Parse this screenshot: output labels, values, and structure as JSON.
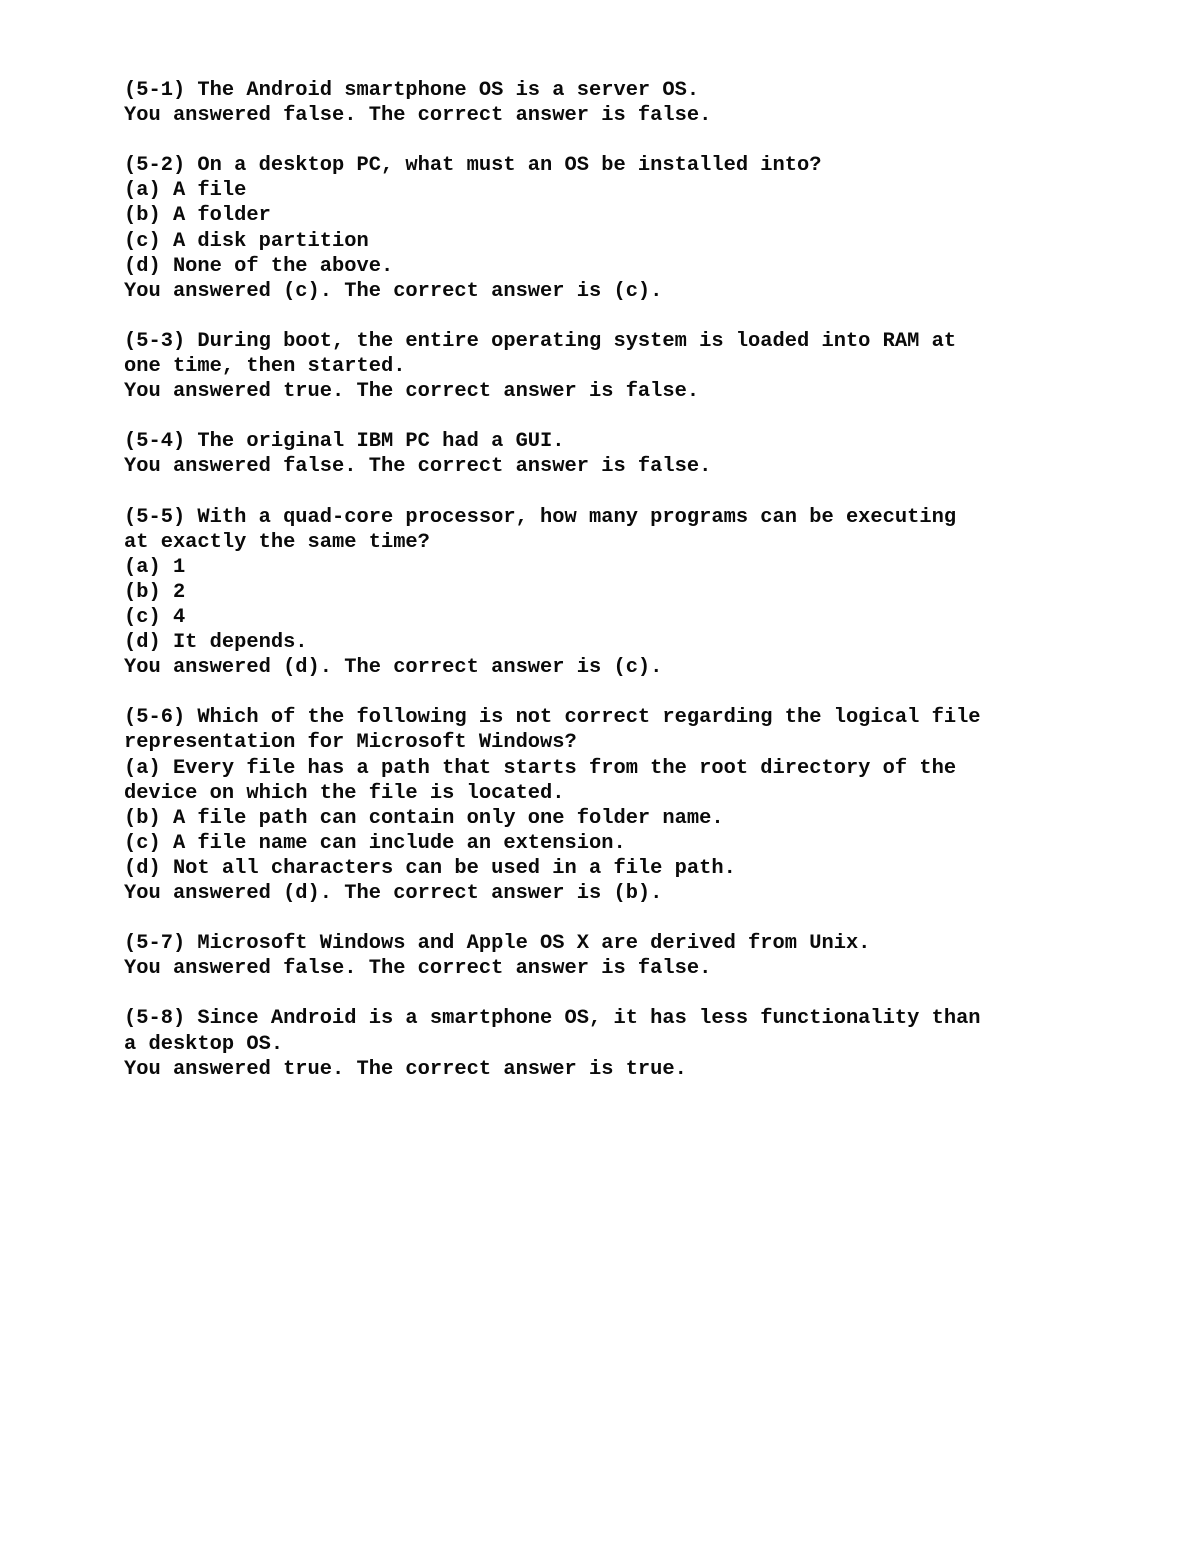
{
  "document": {
    "type": "quiz-answer-review",
    "section": "5",
    "text_color": "#0a0a0a",
    "background_color": "#ffffff",
    "questions": [
      {
        "id": "5-1",
        "lines": [
          "(5-1) The Android smartphone OS is a server OS."
        ],
        "options": [],
        "answer_line": "You answered false. The correct answer is false."
      },
      {
        "id": "5-2",
        "lines": [
          "(5-2) On a desktop PC, what must an OS be installed into?"
        ],
        "options": [
          "(a) A file",
          "(b) A folder",
          "(c) A disk partition",
          "(d) None of the above."
        ],
        "answer_line": "You answered (c). The correct answer is (c)."
      },
      {
        "id": "5-3",
        "lines": [
          "(5-3) During boot, the entire operating system is loaded into RAM at",
          "one time, then started."
        ],
        "options": [],
        "answer_line": "You answered true. The correct answer is false."
      },
      {
        "id": "5-4",
        "lines": [
          "(5-4) The original IBM PC had a GUI."
        ],
        "options": [],
        "answer_line": "You answered false. The correct answer is false."
      },
      {
        "id": "5-5",
        "lines": [
          "(5-5) With a quad-core processor, how many programs can be executing",
          "at exactly the same time?"
        ],
        "options": [
          "(a) 1",
          "(b) 2",
          "(c) 4",
          "(d) It depends."
        ],
        "answer_line": "You answered (d). The correct answer is (c)."
      },
      {
        "id": "5-6",
        "lines": [
          "(5-6) Which of the following is not correct regarding the logical file",
          "representation for Microsoft Windows?"
        ],
        "options": [
          "(a) Every file has a path that starts from the root directory of the",
          "device on which the file is located.",
          "(b) A file path can contain only one folder name.",
          "(c) A file name can include an extension.",
          "(d) Not all characters can be used in a file path."
        ],
        "answer_line": "You answered (d). The correct answer is (b)."
      },
      {
        "id": "5-7",
        "lines": [
          "(5-7) Microsoft Windows and Apple OS X are derived from Unix."
        ],
        "options": [],
        "answer_line": "You answered false. The correct answer is false."
      },
      {
        "id": "5-8",
        "lines": [
          "(5-8) Since Android is a smartphone OS, it has less functionality than",
          "a desktop OS."
        ],
        "options": [],
        "answer_line": "You answered true. The correct answer is true."
      }
    ]
  }
}
